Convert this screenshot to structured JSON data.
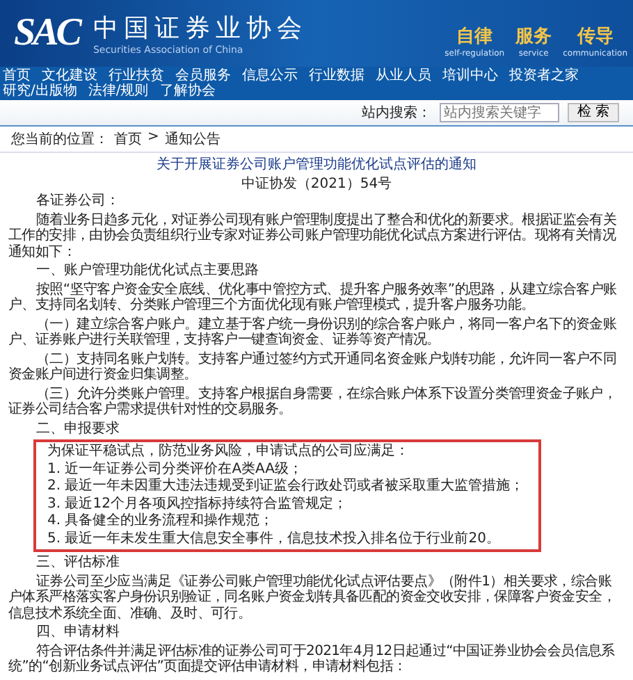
{
  "header": {
    "logo": "SAC",
    "name_cn": "中国证券业协会",
    "name_en": "Securities Association of China",
    "slogans": [
      {
        "cn": "自律",
        "en": "self-regulation"
      },
      {
        "cn": "服务",
        "en": "service"
      },
      {
        "cn": "传导",
        "en": "communication"
      }
    ]
  },
  "nav": [
    "首页",
    "文化建设",
    "行业扶贫",
    "会员服务",
    "信息公示",
    "行业数据",
    "从业人员",
    "培训中心",
    "投资者之家",
    "研究/出版物",
    "法律/规则",
    "了解协会"
  ],
  "search": {
    "label": "站内搜索：",
    "placeholder": "站内搜索关键字",
    "button": "检 索"
  },
  "breadcrumb": {
    "prefix": "您当前的位置：",
    "items": [
      "首页",
      "通知公告"
    ],
    "separator": ">"
  },
  "article": {
    "title": "关于开展证券公司账户管理功能优化试点评估的通知",
    "doc_no": "中证协发（2021）54号",
    "salutation": "各证券公司：",
    "blocks": [
      {
        "kind": "para",
        "text": "随着业务日趋多元化，对证券公司现有账户管理制度提出了整合和优化的新要求。根据证监会有关工作的安排，由协会负责组织行业专家对证券公司账户管理功能优化试点方案进行评估。现将有关情况通知如下："
      },
      {
        "kind": "heading",
        "text": "一、账户管理功能优化试点主要思路"
      },
      {
        "kind": "para",
        "text": "按照“坚守客户资金安全底线、优化事中管控方式、提升客户服务效率”的思路，从建立综合客户账户、支持同名划转、分类账户管理三个方面优化现有账户管理模式，提升客户服务功能。"
      },
      {
        "kind": "para",
        "text": "（一）建立综合客户账户。建立基于客户统一身份识别的综合客户账户，将同一客户名下的资金账户、证券账户进行关联管理，支持客户一键查询资金、证券等资产情况。"
      },
      {
        "kind": "para",
        "text": "（二）支持同名账户划转。支持客户通过签约方式开通同名资金账户划转功能，允许同一客户不同资金账户间进行资金归集调整。"
      },
      {
        "kind": "para",
        "text": "（三）允许分类账户管理。支持客户根据自身需要，在综合账户体系下设置分类管理资金子账户，证券公司结合客户需求提供针对性的交易服务。"
      },
      {
        "kind": "heading",
        "text": "二、申报要求"
      },
      {
        "kind": "boxed",
        "lines": [
          "为保证平稳试点，防范业务风险，申请试点的公司应满足：",
          "1. 近一年证券公司分类评价在A类AA级；",
          "2. 最近一年未因重大违法违规受到证监会行政处罚或者被采取重大监管措施；",
          "3. 最近12个月各项风控指标持续符合监管规定；",
          "4. 具备健全的业务流程和操作规范；",
          "5. 最近一年未发生重大信息安全事件，信息技术投入排名位于行业前20。"
        ]
      },
      {
        "kind": "heading",
        "text": "三、评估标准"
      },
      {
        "kind": "para",
        "text": "证券公司至少应当满足《证券公司账户管理功能优化试点评估要点》（附件1）相关要求，综合账户体系严格落实客户身份识别验证，同名账户资金划转具备匹配的资金交收安排，保障客户资金安全，信息技术系统全面、准确、及时、可行。"
      },
      {
        "kind": "heading",
        "text": "四、申请材料"
      },
      {
        "kind": "para",
        "text": "符合评估条件并满足评估标准的证券公司可于2021年4月12日起通过“中国证券业协会会员信息系统”的“创新业务试点评估”页面提交评估申请材料，申请材料包括："
      }
    ]
  }
}
